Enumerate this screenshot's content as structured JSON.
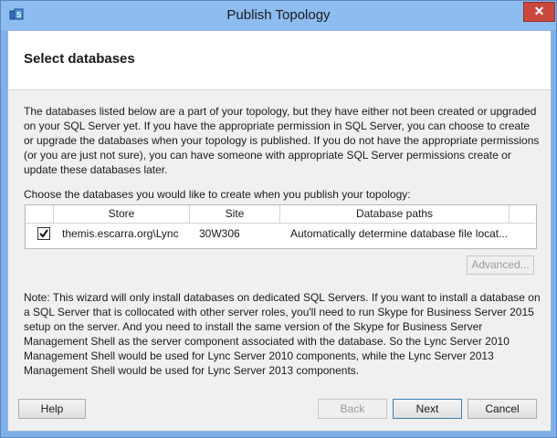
{
  "window": {
    "title": "Publish Topology",
    "close_glyph": "✕"
  },
  "header": {
    "title": "Select databases"
  },
  "intro_text": "The databases listed below are a part of your topology, but they have either not been created or upgraded on your SQL Server yet. If you have the appropriate permission in SQL Server, you can choose to create or upgrade the databases when your topology is published. If you do not have the appropriate permissions (or you are just not sure), you can have someone with appropriate SQL Server permissions create or update these databases later.",
  "choose_label": "Choose the databases you would like to create when you publish your topology:",
  "grid": {
    "columns": [
      "Store",
      "Site",
      "Database paths"
    ],
    "rows": [
      {
        "checked": true,
        "store": "themis.escarra.org\\Lync",
        "site": "30W306",
        "paths": "Automatically determine database file locat..."
      }
    ]
  },
  "advanced_label": "Advanced...",
  "note_text": "Note: This wizard will only install databases on dedicated SQL Servers. If you want to install a database on a SQL Server that is collocated with other server roles, you'll need to run Skype for Business Server 2015 setup on the server. And you need to install the same version of the Skype for Business Server Management Shell as the server component associated with the database. So the Lync Server 2010 Management Shell would be used for Lync Server 2010 components, while the Lync Server 2013 Management Shell would be used for Lync Server 2013 components.",
  "buttons": {
    "help": "Help",
    "back": "Back",
    "next": "Next",
    "cancel": "Cancel"
  },
  "icons": {
    "app": "topology-builder-icon",
    "checkbox": "checkmark-icon"
  }
}
